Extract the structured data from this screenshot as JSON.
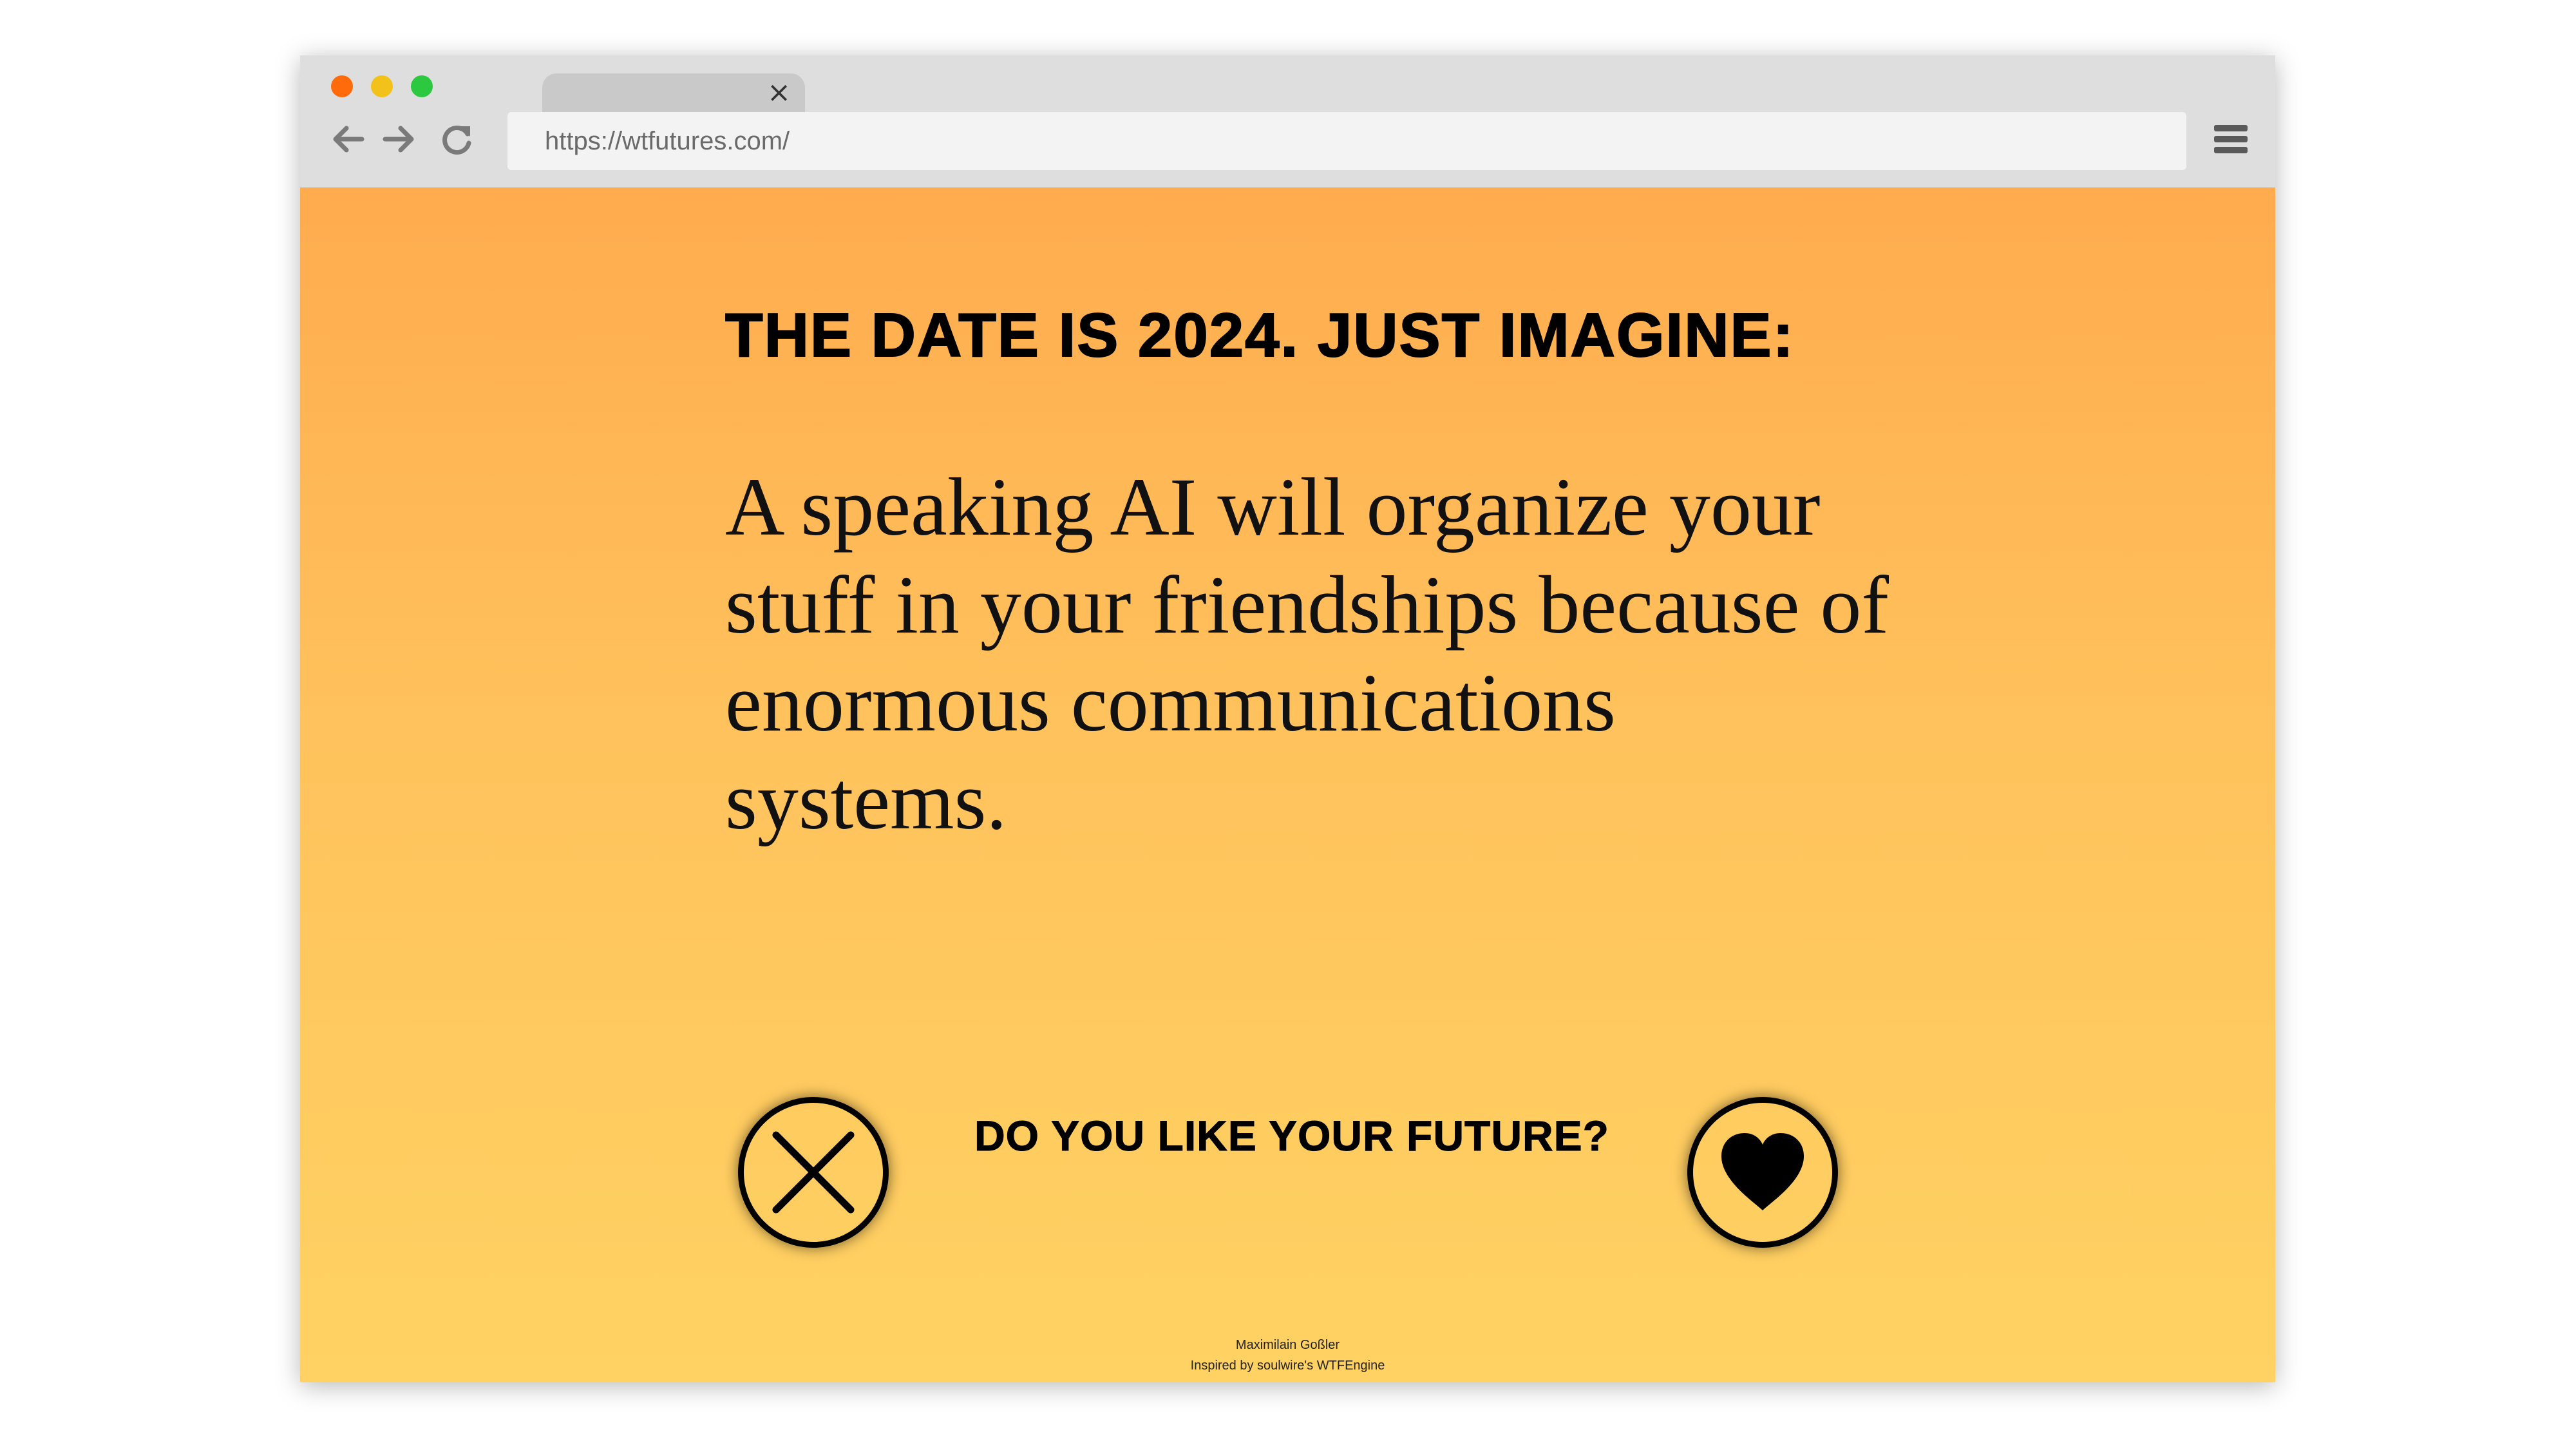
{
  "browser": {
    "tab_close": "×",
    "url": "https://wtfutures.com/",
    "traffic_lights": [
      "#ff6b0a",
      "#f2c11a",
      "#2bc840"
    ],
    "icons": [
      "back-arrow-icon",
      "forward-arrow-icon",
      "reload-icon",
      "hamburger-menu-icon"
    ]
  },
  "page": {
    "headline": "THE DATE IS 2024. JUST IMAGINE:",
    "story": "A speaking AI will organize your stuff in your friendships because of enormous communications systems.",
    "question": "DO YOU LIKE YOUR FUTURE?",
    "dislike_icon": "x-icon",
    "like_icon": "heart-icon",
    "footer_author": "Maximilain Goßler",
    "footer_credit": "Inspired by soulwire's WTFEngine",
    "gradient_top": "#ffab4e",
    "gradient_bottom": "#ffd263"
  }
}
